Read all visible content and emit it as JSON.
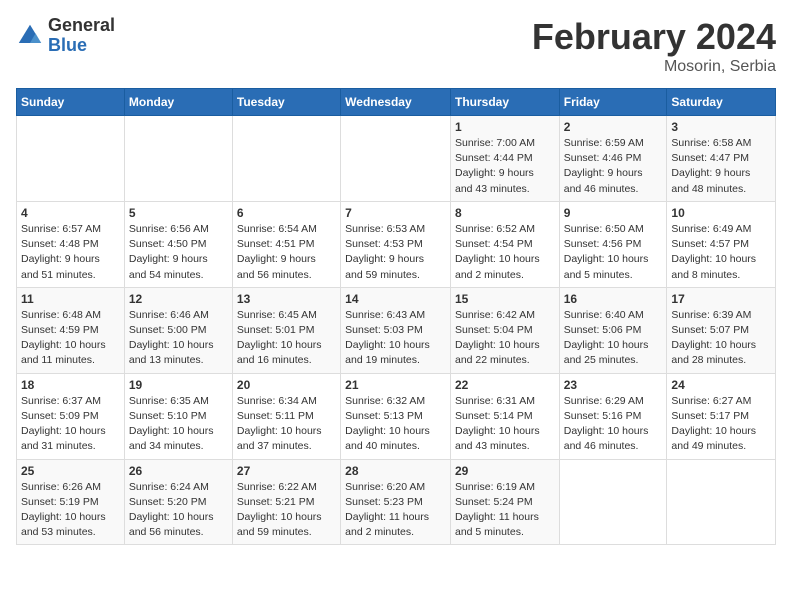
{
  "header": {
    "logo_general": "General",
    "logo_blue": "Blue",
    "title": "February 2024",
    "location": "Mosorin, Serbia"
  },
  "weekdays": [
    "Sunday",
    "Monday",
    "Tuesday",
    "Wednesday",
    "Thursday",
    "Friday",
    "Saturday"
  ],
  "weeks": [
    [
      {
        "day": "",
        "info": ""
      },
      {
        "day": "",
        "info": ""
      },
      {
        "day": "",
        "info": ""
      },
      {
        "day": "",
        "info": ""
      },
      {
        "day": "1",
        "info": "Sunrise: 7:00 AM\nSunset: 4:44 PM\nDaylight: 9 hours\nand 43 minutes."
      },
      {
        "day": "2",
        "info": "Sunrise: 6:59 AM\nSunset: 4:46 PM\nDaylight: 9 hours\nand 46 minutes."
      },
      {
        "day": "3",
        "info": "Sunrise: 6:58 AM\nSunset: 4:47 PM\nDaylight: 9 hours\nand 48 minutes."
      }
    ],
    [
      {
        "day": "4",
        "info": "Sunrise: 6:57 AM\nSunset: 4:48 PM\nDaylight: 9 hours\nand 51 minutes."
      },
      {
        "day": "5",
        "info": "Sunrise: 6:56 AM\nSunset: 4:50 PM\nDaylight: 9 hours\nand 54 minutes."
      },
      {
        "day": "6",
        "info": "Sunrise: 6:54 AM\nSunset: 4:51 PM\nDaylight: 9 hours\nand 56 minutes."
      },
      {
        "day": "7",
        "info": "Sunrise: 6:53 AM\nSunset: 4:53 PM\nDaylight: 9 hours\nand 59 minutes."
      },
      {
        "day": "8",
        "info": "Sunrise: 6:52 AM\nSunset: 4:54 PM\nDaylight: 10 hours\nand 2 minutes."
      },
      {
        "day": "9",
        "info": "Sunrise: 6:50 AM\nSunset: 4:56 PM\nDaylight: 10 hours\nand 5 minutes."
      },
      {
        "day": "10",
        "info": "Sunrise: 6:49 AM\nSunset: 4:57 PM\nDaylight: 10 hours\nand 8 minutes."
      }
    ],
    [
      {
        "day": "11",
        "info": "Sunrise: 6:48 AM\nSunset: 4:59 PM\nDaylight: 10 hours\nand 11 minutes."
      },
      {
        "day": "12",
        "info": "Sunrise: 6:46 AM\nSunset: 5:00 PM\nDaylight: 10 hours\nand 13 minutes."
      },
      {
        "day": "13",
        "info": "Sunrise: 6:45 AM\nSunset: 5:01 PM\nDaylight: 10 hours\nand 16 minutes."
      },
      {
        "day": "14",
        "info": "Sunrise: 6:43 AM\nSunset: 5:03 PM\nDaylight: 10 hours\nand 19 minutes."
      },
      {
        "day": "15",
        "info": "Sunrise: 6:42 AM\nSunset: 5:04 PM\nDaylight: 10 hours\nand 22 minutes."
      },
      {
        "day": "16",
        "info": "Sunrise: 6:40 AM\nSunset: 5:06 PM\nDaylight: 10 hours\nand 25 minutes."
      },
      {
        "day": "17",
        "info": "Sunrise: 6:39 AM\nSunset: 5:07 PM\nDaylight: 10 hours\nand 28 minutes."
      }
    ],
    [
      {
        "day": "18",
        "info": "Sunrise: 6:37 AM\nSunset: 5:09 PM\nDaylight: 10 hours\nand 31 minutes."
      },
      {
        "day": "19",
        "info": "Sunrise: 6:35 AM\nSunset: 5:10 PM\nDaylight: 10 hours\nand 34 minutes."
      },
      {
        "day": "20",
        "info": "Sunrise: 6:34 AM\nSunset: 5:11 PM\nDaylight: 10 hours\nand 37 minutes."
      },
      {
        "day": "21",
        "info": "Sunrise: 6:32 AM\nSunset: 5:13 PM\nDaylight: 10 hours\nand 40 minutes."
      },
      {
        "day": "22",
        "info": "Sunrise: 6:31 AM\nSunset: 5:14 PM\nDaylight: 10 hours\nand 43 minutes."
      },
      {
        "day": "23",
        "info": "Sunrise: 6:29 AM\nSunset: 5:16 PM\nDaylight: 10 hours\nand 46 minutes."
      },
      {
        "day": "24",
        "info": "Sunrise: 6:27 AM\nSunset: 5:17 PM\nDaylight: 10 hours\nand 49 minutes."
      }
    ],
    [
      {
        "day": "25",
        "info": "Sunrise: 6:26 AM\nSunset: 5:19 PM\nDaylight: 10 hours\nand 53 minutes."
      },
      {
        "day": "26",
        "info": "Sunrise: 6:24 AM\nSunset: 5:20 PM\nDaylight: 10 hours\nand 56 minutes."
      },
      {
        "day": "27",
        "info": "Sunrise: 6:22 AM\nSunset: 5:21 PM\nDaylight: 10 hours\nand 59 minutes."
      },
      {
        "day": "28",
        "info": "Sunrise: 6:20 AM\nSunset: 5:23 PM\nDaylight: 11 hours\nand 2 minutes."
      },
      {
        "day": "29",
        "info": "Sunrise: 6:19 AM\nSunset: 5:24 PM\nDaylight: 11 hours\nand 5 minutes."
      },
      {
        "day": "",
        "info": ""
      },
      {
        "day": "",
        "info": ""
      }
    ]
  ]
}
